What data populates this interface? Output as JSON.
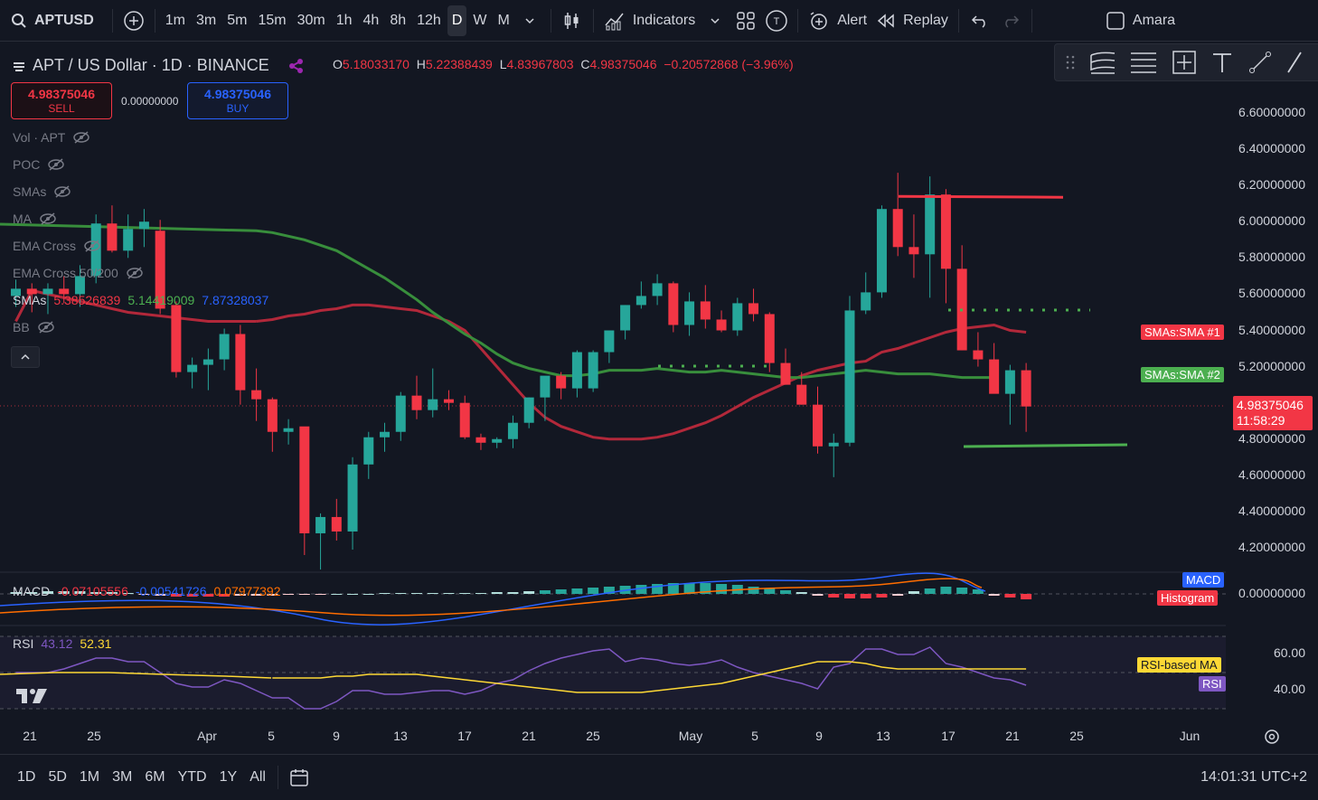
{
  "topbar": {
    "symbol": "APTUSD",
    "timeframes": [
      "1m",
      "3m",
      "5m",
      "15m",
      "30m",
      "1h",
      "4h",
      "8h",
      "12h",
      "D",
      "W",
      "M"
    ],
    "active_timeframe": "D",
    "indicators_label": "Indicators",
    "alert_label": "Alert",
    "replay_label": "Replay",
    "user_label": "Amara"
  },
  "header": {
    "pair": "APT / US Dollar · 1D · BINANCE",
    "ohlc": {
      "o_label": "O",
      "o": "5.18033170",
      "h_label": "H",
      "h": "5.22388439",
      "l_label": "L",
      "l": "4.83967803",
      "c_label": "C",
      "c": "4.98375046",
      "change": "−0.20572868 (−3.96%)"
    }
  },
  "trade": {
    "sell_price": "4.98375046",
    "sell_label": "SELL",
    "spread": "0.00000000",
    "buy_price": "4.98375046",
    "buy_label": "BUY"
  },
  "legend": {
    "vol": "Vol · APT",
    "poc": "POC",
    "smas_hidden": "SMAs",
    "ma": "MA",
    "ema_cross": "EMA Cross",
    "ema_cross_50_200": "EMA Cross 50/200",
    "smas": "SMAs",
    "sma1": "5.38526839",
    "sma2": "5.14419009",
    "sma3": "7.87328037",
    "bb": "BB"
  },
  "price_axis": [
    "6.60000000",
    "6.40000000",
    "6.20000000",
    "6.00000000",
    "5.80000000",
    "5.60000000",
    "5.40000000",
    "5.20000000",
    "4.80000000",
    "4.60000000",
    "4.40000000",
    "4.20000000"
  ],
  "tags": {
    "sma1": "SMAs:SMA #1",
    "sma2": "SMAs:SMA #2",
    "last_price": "4.98375046",
    "countdown": "11:58:29"
  },
  "macd": {
    "label": "MACD",
    "v1": "-0.07105556",
    "v2": "-0.00541726",
    "v3": "0.07977392",
    "axis_zero": "0.00000000",
    "tag_macd": "MACD",
    "tag_hist": "Histogram"
  },
  "rsi": {
    "label": "RSI",
    "v1": "43.12",
    "v2": "52.31",
    "axis60": "60.00",
    "axis40": "40.00",
    "tag_ma": "RSI-based MA",
    "tag_rsi": "RSI"
  },
  "time_axis": [
    "21",
    "25",
    "Apr",
    "5",
    "9",
    "13",
    "17",
    "21",
    "25",
    "May",
    "5",
    "9",
    "13",
    "17",
    "21",
    "25",
    "Jun"
  ],
  "bottombar": {
    "ranges": [
      "1D",
      "5D",
      "1M",
      "3M",
      "6M",
      "YTD",
      "1Y",
      "All"
    ],
    "clock": "14:01:31 UTC+2"
  },
  "colors": {
    "up": "#26a69a",
    "down": "#f23645",
    "sma_red": "#b2283a",
    "sma_green": "#388e3c",
    "background": "#131722"
  },
  "chart_data": {
    "type": "candlestick",
    "candles": [
      [
        5.59,
        5.68,
        5.53,
        5.63
      ],
      [
        5.63,
        5.66,
        5.5,
        5.6
      ],
      [
        5.6,
        5.66,
        5.49,
        5.63
      ],
      [
        5.63,
        5.7,
        5.55,
        5.6
      ],
      [
        5.6,
        5.76,
        5.53,
        5.7
      ],
      [
        5.7,
        6.04,
        5.66,
        5.99
      ],
      [
        5.99,
        6.09,
        5.83,
        5.84
      ],
      [
        5.84,
        6.04,
        5.8,
        5.96
      ],
      [
        5.96,
        6.07,
        5.86,
        6.0
      ],
      [
        5.95,
        6.01,
        5.49,
        5.52
      ],
      [
        5.54,
        5.56,
        5.14,
        5.17
      ],
      [
        5.17,
        5.25,
        5.08,
        5.21
      ],
      [
        5.21,
        5.3,
        5.07,
        5.24
      ],
      [
        5.24,
        5.41,
        5.18,
        5.38
      ],
      [
        5.38,
        5.43,
        4.99,
        5.07
      ],
      [
        5.07,
        5.19,
        4.9,
        5.02
      ],
      [
        5.02,
        5.03,
        4.73,
        4.84
      ],
      [
        4.84,
        4.91,
        4.77,
        4.86
      ],
      [
        4.87,
        4.85,
        4.16,
        4.28
      ],
      [
        4.28,
        4.39,
        4.08,
        4.37
      ],
      [
        4.37,
        4.47,
        4.24,
        4.29
      ],
      [
        4.29,
        4.7,
        4.19,
        4.66
      ],
      [
        4.66,
        4.84,
        4.58,
        4.81
      ],
      [
        4.81,
        4.89,
        4.73,
        4.84
      ],
      [
        4.84,
        5.06,
        4.79,
        5.04
      ],
      [
        5.04,
        5.15,
        4.91,
        4.96
      ],
      [
        4.96,
        5.19,
        4.92,
        5.02
      ],
      [
        5.02,
        5.07,
        4.96,
        5.0
      ],
      [
        5.0,
        5.04,
        4.8,
        4.81
      ],
      [
        4.81,
        4.83,
        4.74,
        4.78
      ],
      [
        4.78,
        4.81,
        4.75,
        4.8
      ],
      [
        4.8,
        4.93,
        4.75,
        4.89
      ],
      [
        4.89,
        5.03,
        4.86,
        5.03
      ],
      [
        5.03,
        5.12,
        4.9,
        5.15
      ],
      [
        5.15,
        5.17,
        5.02,
        5.08
      ],
      [
        5.08,
        5.29,
        5.03,
        5.28
      ],
      [
        5.08,
        5.29,
        5.06,
        5.28
      ],
      [
        5.28,
        5.38,
        5.22,
        5.4
      ],
      [
        5.4,
        5.54,
        5.35,
        5.54
      ],
      [
        5.54,
        5.67,
        5.52,
        5.59
      ],
      [
        5.59,
        5.71,
        5.54,
        5.66
      ],
      [
        5.66,
        5.67,
        5.39,
        5.43
      ],
      [
        5.43,
        5.61,
        5.37,
        5.56
      ],
      [
        5.56,
        5.65,
        5.41,
        5.46
      ],
      [
        5.46,
        5.51,
        5.39,
        5.4
      ],
      [
        5.4,
        5.58,
        5.37,
        5.55
      ],
      [
        5.55,
        5.63,
        5.45,
        5.49
      ],
      [
        5.49,
        5.5,
        5.17,
        5.22
      ],
      [
        5.22,
        5.3,
        5.1,
        5.1
      ],
      [
        5.1,
        5.17,
        4.99,
        4.99
      ],
      [
        4.99,
        5.09,
        4.72,
        4.76
      ],
      [
        4.76,
        4.83,
        4.59,
        4.78
      ],
      [
        4.78,
        5.59,
        4.76,
        5.51
      ],
      [
        5.51,
        5.72,
        5.49,
        5.61
      ],
      [
        5.61,
        6.09,
        5.58,
        6.07
      ],
      [
        6.07,
        6.27,
        5.81,
        5.86
      ],
      [
        5.86,
        6.04,
        5.69,
        5.82
      ],
      [
        5.82,
        6.25,
        5.58,
        6.15
      ],
      [
        6.15,
        6.18,
        5.55,
        5.74
      ],
      [
        5.74,
        5.87,
        5.29,
        5.29
      ],
      [
        5.29,
        5.39,
        5.2,
        5.24
      ],
      [
        5.24,
        5.33,
        5.09,
        5.05
      ],
      [
        5.05,
        5.21,
        4.88,
        5.18
      ],
      [
        5.18,
        5.22,
        4.84,
        4.98
      ]
    ],
    "sma_red": [
      5.45,
      5.46,
      5.48,
      5.49,
      5.51,
      5.52,
      5.54,
      5.54,
      5.53,
      5.52,
      5.51,
      5.48,
      5.45,
      5.4,
      5.3,
      5.2,
      5.1,
      5.0,
      4.92,
      4.87,
      4.84,
      4.81,
      4.8,
      4.8,
      4.8,
      4.81,
      4.83,
      4.86,
      4.89,
      4.93,
      4.98,
      5.03,
      5.07,
      5.11,
      5.15,
      5.18,
      5.2,
      5.22,
      5.23,
      5.28,
      5.3,
      5.33,
      5.36,
      5.39,
      5.41,
      5.42,
      5.43,
      5.4,
      5.39
    ],
    "sma_green": [
      5.95,
      5.94,
      5.92,
      5.9,
      5.87,
      5.84,
      5.79,
      5.74,
      5.69,
      5.63,
      5.57,
      5.5,
      5.44,
      5.38,
      5.33,
      5.27,
      5.22,
      5.19,
      5.17,
      5.15,
      5.15,
      5.16,
      5.18,
      5.18,
      5.18,
      5.19,
      5.18,
      5.17,
      5.17,
      5.18,
      5.17,
      5.16,
      5.15,
      5.14,
      5.14,
      5.15,
      5.16,
      5.17,
      5.18,
      5.17,
      5.16,
      5.16,
      5.16,
      5.15,
      5.14,
      5.14,
      5.14
    ],
    "levels": {
      "resistance": 6.14,
      "support": 4.76,
      "dotted_top": 5.5
    },
    "rsi": [
      50,
      50,
      50,
      52,
      55,
      58,
      58,
      56,
      56,
      50,
      44,
      42,
      42,
      46,
      44,
      40,
      36,
      36,
      30,
      30,
      34,
      40,
      40,
      38,
      38,
      39,
      40,
      40,
      38,
      40,
      44,
      46,
      51,
      55,
      58,
      60,
      62,
      63,
      56,
      58,
      57,
      55,
      54,
      55,
      57,
      53,
      50,
      48,
      46,
      44,
      41,
      53,
      55,
      63,
      63,
      60,
      60,
      64,
      55,
      53,
      50,
      47,
      46,
      43
    ],
    "rsi_ma": [
      47,
      47,
      47,
      47,
      48,
      48,
      49,
      49,
      49,
      49,
      48,
      47,
      46,
      45,
      44,
      43,
      42,
      41,
      40,
      39,
      39,
      39,
      39,
      39,
      40,
      41,
      42,
      43,
      44,
      46,
      48,
      50,
      52,
      54,
      56,
      56,
      56,
      55,
      53,
      52,
      52,
      52,
      52,
      52,
      52,
      52,
      52,
      52
    ],
    "price_range": [
      4.05,
      6.7
    ],
    "x_labels": [
      "21",
      "25",
      "Apr",
      "5",
      "9",
      "13",
      "17",
      "21",
      "25",
      "May",
      "5",
      "9",
      "13",
      "17",
      "21",
      "25",
      "Jun"
    ]
  }
}
